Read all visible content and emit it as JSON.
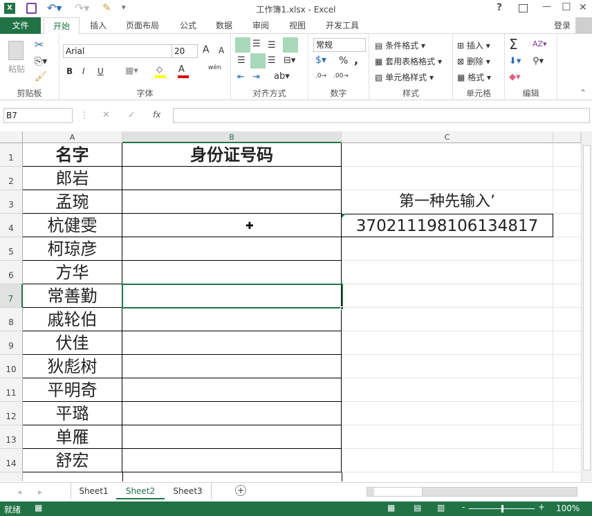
{
  "titlebar": {
    "title": "工作簿1.xlsx - Excel",
    "help": "?",
    "minimize": "—",
    "maximize": "☐",
    "close": "✕"
  },
  "tabs": {
    "file": "文件",
    "items": [
      "开始",
      "插入",
      "页面布局",
      "公式",
      "数据",
      "审阅",
      "视图",
      "开发工具"
    ],
    "active": "开始",
    "login": "登录"
  },
  "ribbon": {
    "clipboard": {
      "label": "剪贴板",
      "paste": "粘贴"
    },
    "font": {
      "label": "字体",
      "name": "Arial",
      "size": "20",
      "bold": "B",
      "italic": "I",
      "underline": "U",
      "phonetic": "wén",
      "font_color": "#e00000",
      "fill_color": "#ffff00"
    },
    "alignment": {
      "label": "对齐方式"
    },
    "number": {
      "label": "数字",
      "format": "常规",
      "percent": "%",
      "comma": ","
    },
    "styles": {
      "label": "样式",
      "conditional": "条件格式",
      "table": "套用表格格式",
      "cell": "单元格样式"
    },
    "cells": {
      "label": "单元格",
      "insert": "插入",
      "delete": "删除",
      "format": "格式"
    },
    "editing": {
      "label": "编辑",
      "sum": "Σ"
    }
  },
  "formula_bar": {
    "name_box": "B7",
    "fx": "fx",
    "value": ""
  },
  "columns": [
    "A",
    "B",
    "C"
  ],
  "rows": [
    {
      "n": "1",
      "a": "名字",
      "b": "身份证号码",
      "c": ""
    },
    {
      "n": "2",
      "a": "郎岩",
      "b": "",
      "c": ""
    },
    {
      "n": "3",
      "a": "孟琬",
      "b": "",
      "c": "第一种先输入’"
    },
    {
      "n": "4",
      "a": "杭健雯",
      "b": "",
      "c": "370211198106134817"
    },
    {
      "n": "5",
      "a": "柯琼彦",
      "b": "",
      "c": ""
    },
    {
      "n": "6",
      "a": "方华",
      "b": "",
      "c": ""
    },
    {
      "n": "7",
      "a": "常善勤",
      "b": "",
      "c": ""
    },
    {
      "n": "8",
      "a": "戚轮伯",
      "b": "",
      "c": ""
    },
    {
      "n": "9",
      "a": "伏佳",
      "b": "",
      "c": ""
    },
    {
      "n": "10",
      "a": "狄彪树",
      "b": "",
      "c": ""
    },
    {
      "n": "11",
      "a": "平明奇",
      "b": "",
      "c": ""
    },
    {
      "n": "12",
      "a": "平璐",
      "b": "",
      "c": ""
    },
    {
      "n": "13",
      "a": "单雁",
      "b": "",
      "c": ""
    },
    {
      "n": "14",
      "a": "舒宏",
      "b": "",
      "c": ""
    }
  ],
  "sheets": {
    "items": [
      "Sheet1",
      "Sheet2",
      "Sheet3"
    ],
    "active": "Sheet2",
    "add": "+"
  },
  "status": {
    "ready": "就绪",
    "zoom": "100%",
    "zoom_level": 100
  },
  "colors": {
    "accent": "#217346",
    "selection": "#217346"
  }
}
